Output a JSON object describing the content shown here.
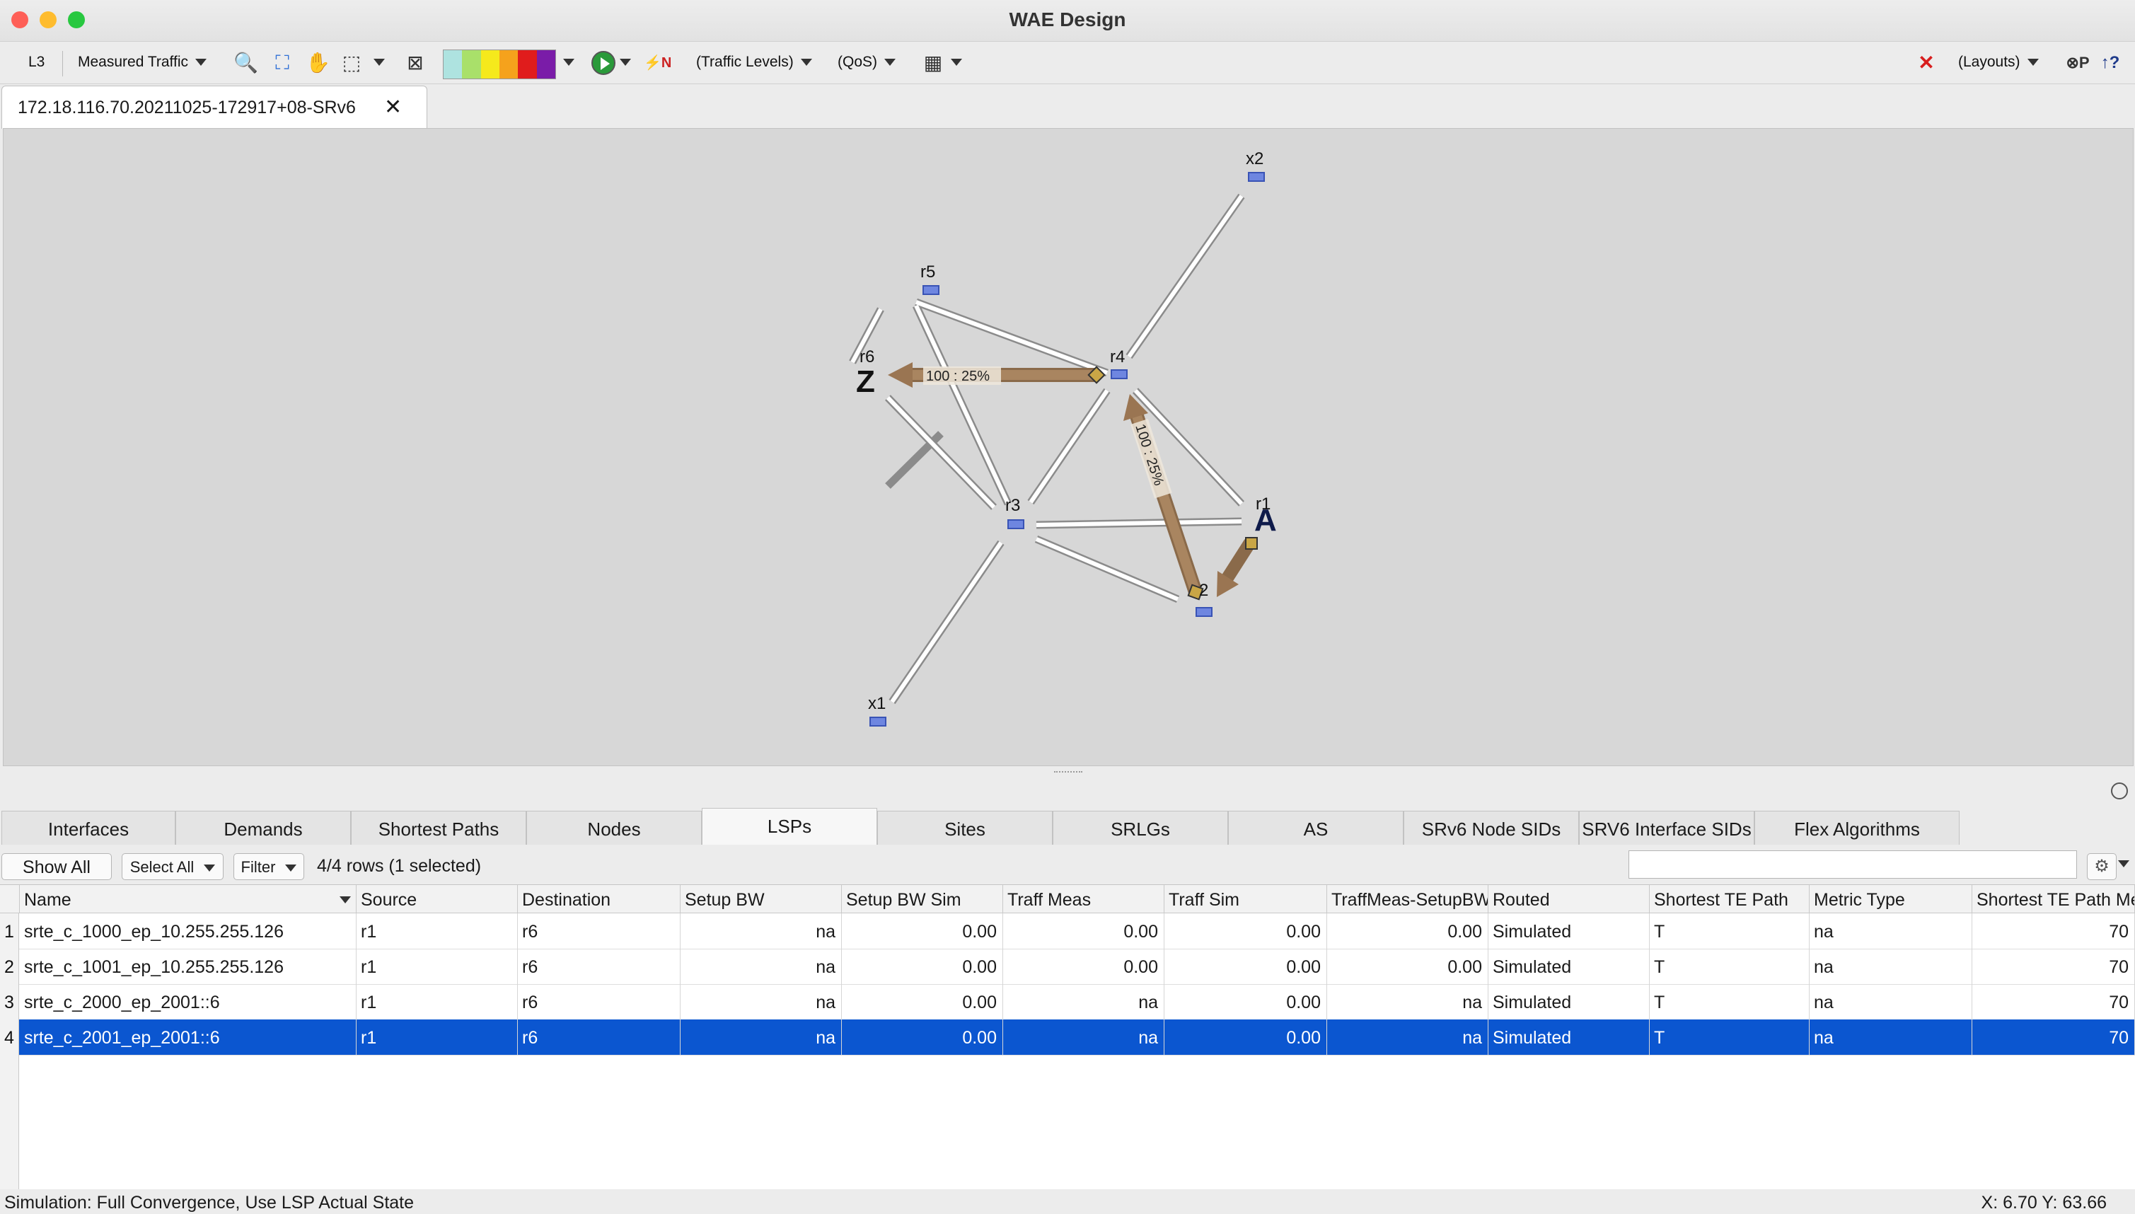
{
  "window": {
    "title": "WAE Design"
  },
  "toolbar": {
    "layer": "L3",
    "traffic_mode": "Measured Traffic",
    "traffic_levels": "(Traffic Levels)",
    "qos": "(QoS)",
    "layouts": "(Layouts)",
    "utilization_colors": [
      "#aee3e0",
      "#a9e06a",
      "#f5e91c",
      "#f5a21c",
      "#e01c1c",
      "#7a1ca8"
    ]
  },
  "document_tab": {
    "label": "172.18.116.70.20211025-172917+08-SRv6",
    "close": "✕"
  },
  "topology": {
    "nodes": [
      "x2",
      "r5",
      "r6",
      "r4",
      "r1",
      "r3",
      "2",
      "x1"
    ],
    "site_markers": {
      "source": "A",
      "destination": "Z"
    },
    "lsp_labels": [
      "100 : 25%",
      "100 : 25%"
    ]
  },
  "bottom_tabs": [
    "Interfaces",
    "Demands",
    "Shortest Paths",
    "Nodes",
    "LSPs",
    "Sites",
    "SRLGs",
    "AS",
    "SRv6 Node SIDs",
    "SRV6 Interface SIDs",
    "Flex Algorithms"
  ],
  "active_tab": "LSPs",
  "table_controls": {
    "show_all": "Show All",
    "select_all": "Select All",
    "filter": "Filter",
    "row_count": "4/4 rows (1 selected)",
    "search_placeholder": ""
  },
  "table": {
    "columns": [
      "Name",
      "Source",
      "Destination",
      "Setup BW",
      "Setup BW Sim",
      "Traff Meas",
      "Traff Sim",
      "TraffMeas-SetupBW",
      "Routed",
      "Shortest TE Path",
      "Metric Type",
      "Shortest TE Path Metric"
    ],
    "rows": [
      {
        "n": "1",
        "name": "srte_c_1000_ep_10.255.255.126",
        "source": "r1",
        "destination": "r6",
        "setup_bw": "na",
        "setup_bw_sim": "0.00",
        "traff_meas": "0.00",
        "traff_sim": "0.00",
        "traff_meas_setup": "0.00",
        "routed": "Simulated",
        "shortest_te_path": "T",
        "metric_type": "na",
        "shortest_te_metric": "70"
      },
      {
        "n": "2",
        "name": "srte_c_1001_ep_10.255.255.126",
        "source": "r1",
        "destination": "r6",
        "setup_bw": "na",
        "setup_bw_sim": "0.00",
        "traff_meas": "0.00",
        "traff_sim": "0.00",
        "traff_meas_setup": "0.00",
        "routed": "Simulated",
        "shortest_te_path": "T",
        "metric_type": "na",
        "shortest_te_metric": "70"
      },
      {
        "n": "3",
        "name": "srte_c_2000_ep_2001::6",
        "source": "r1",
        "destination": "r6",
        "setup_bw": "na",
        "setup_bw_sim": "0.00",
        "traff_meas": "na",
        "traff_sim": "0.00",
        "traff_meas_setup": "na",
        "routed": "Simulated",
        "shortest_te_path": "T",
        "metric_type": "na",
        "shortest_te_metric": "70"
      },
      {
        "n": "4",
        "name": "srte_c_2001_ep_2001::6",
        "source": "r1",
        "destination": "r6",
        "setup_bw": "na",
        "setup_bw_sim": "0.00",
        "traff_meas": "na",
        "traff_sim": "0.00",
        "traff_meas_setup": "na",
        "routed": "Simulated",
        "shortest_te_path": "T",
        "metric_type": "na",
        "shortest_te_metric": "70"
      }
    ],
    "selected_row": 4
  },
  "status": {
    "left": "Simulation: Full Convergence, Use LSP Actual State",
    "right": "X: 6.70  Y: 63.66"
  }
}
